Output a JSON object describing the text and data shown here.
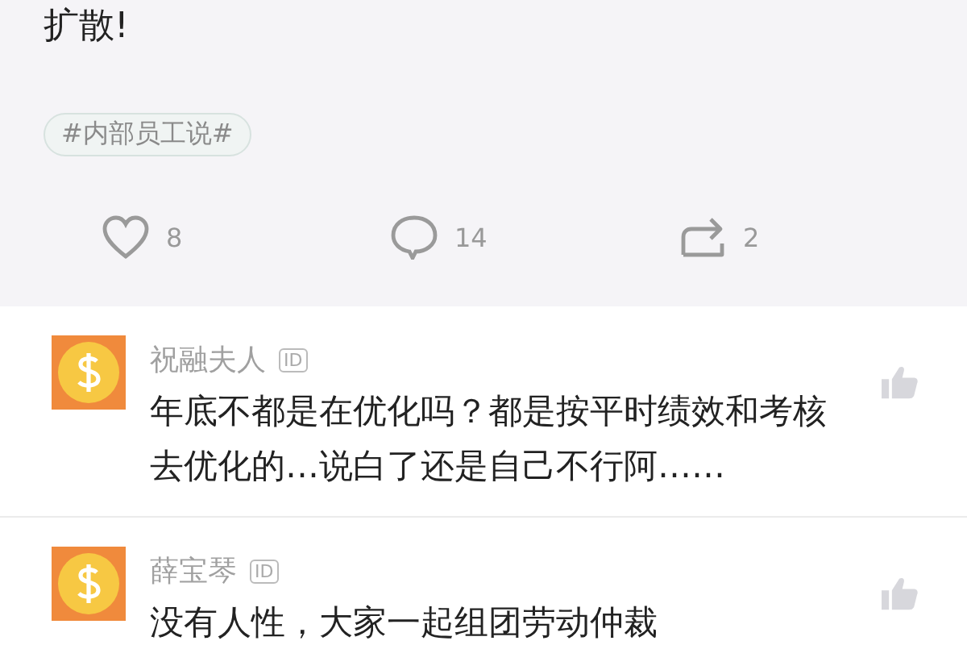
{
  "post": {
    "text": "扩散!",
    "tag": "#内部员工说#",
    "actions": [
      {
        "kind": "like",
        "count": "8"
      },
      {
        "kind": "comment",
        "count": "14"
      },
      {
        "kind": "repost",
        "count": "2"
      }
    ]
  },
  "comments": [
    {
      "name": "祝融夫人",
      "badge": "ID",
      "text": "年底不都是在优化吗？都是按平时绩效和考核去优化的…说白了还是自己不行阿……"
    },
    {
      "name": "薛宝琴",
      "badge": "ID",
      "text": "没有人性，大家一起组团劳动仲裁"
    }
  ]
}
